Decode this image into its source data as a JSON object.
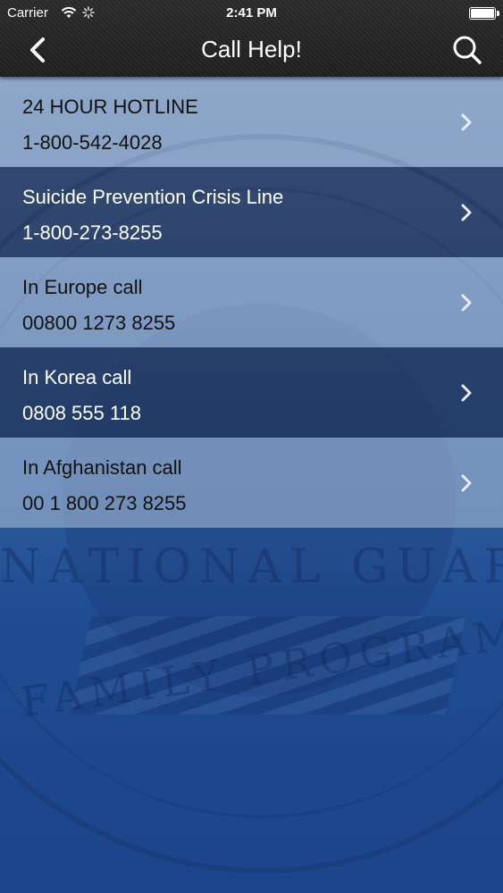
{
  "status_bar": {
    "carrier": "Carrier",
    "time": "2:41 PM",
    "icons": [
      "wifi-icon",
      "activity-icon",
      "battery-icon"
    ]
  },
  "nav": {
    "title": "Call Help!",
    "left_icon": "back-chevron-icon",
    "right_icon": "search-icon"
  },
  "hotlines": [
    {
      "title": "24 HOUR HOTLINE",
      "number": "1-800-542-4028",
      "style": "light"
    },
    {
      "title": "Suicide Prevention Crisis Line",
      "number": "1-800-273-8255",
      "style": "dark"
    },
    {
      "title": "In Europe call",
      "number": "00800 1273 8255",
      "style": "light"
    },
    {
      "title": "In Korea call",
      "number": "0808 555 118",
      "style": "dark"
    },
    {
      "title": "In Afghanistan call",
      "number": "00 1 800 273 8255",
      "style": "light"
    }
  ],
  "background": {
    "watermark_text_top": "NATIONAL GUARD",
    "watermark_text_bottom": "FAMILY PROGRAM"
  },
  "colors": {
    "header": "#222222",
    "row_light": "#a0b4d2",
    "row_dark": "#1e3056",
    "background_blue": "#1f4c91",
    "chevron_light": "#e8eef6"
  }
}
